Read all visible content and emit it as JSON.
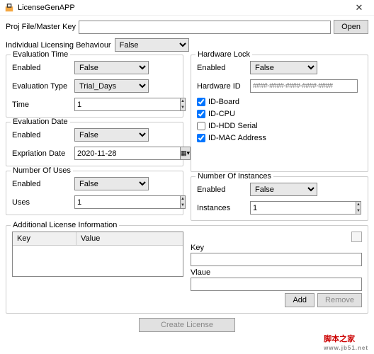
{
  "window": {
    "title": "LicenseGenAPP",
    "close": "✕"
  },
  "top": {
    "label": "Proj File/Master Key",
    "value": "",
    "open": "Open"
  },
  "ilb": {
    "label": "Individual Licensing Behaviour",
    "value": "False"
  },
  "evalTime": {
    "title": "Evaluation Time",
    "enabledLabel": "Enabled",
    "enabledValue": "False",
    "typeLabel": "Evaluation Type",
    "typeValue": "Trial_Days",
    "timeLabel": "Time",
    "timeValue": "1"
  },
  "evalDate": {
    "title": "Evaluation Date",
    "enabledLabel": "Enabled",
    "enabledValue": "False",
    "exprLabel": "Expriation Date",
    "exprValue": "2020-11-28"
  },
  "uses": {
    "title": "Number Of Uses",
    "enabledLabel": "Enabled",
    "enabledValue": "False",
    "usesLabel": "Uses",
    "usesValue": "1"
  },
  "hw": {
    "title": "Hardware Lock",
    "enabledLabel": "Enabled",
    "enabledValue": "False",
    "idLabel": "Hardware ID",
    "idValue": "####-####-####-####-####",
    "board": "ID-Board",
    "cpu": "ID-CPU",
    "hdd": "ID-HDD Serial",
    "mac": "ID-MAC Address",
    "boardChk": true,
    "cpuChk": true,
    "hddChk": false,
    "macChk": true
  },
  "inst": {
    "title": "Number Of Instances",
    "enabledLabel": "Enabled",
    "enabledValue": "False",
    "instLabel": "Instances",
    "instValue": "1"
  },
  "addl": {
    "title": "Additional License Information",
    "colKey": "Key",
    "colValue": "Value",
    "kvKey": "Key",
    "kvValue": "Vlaue",
    "add": "Add",
    "remove": "Remove"
  },
  "create": "Create License",
  "watermark": {
    "text": "脚本之家",
    "url": "www.jb51.net"
  }
}
